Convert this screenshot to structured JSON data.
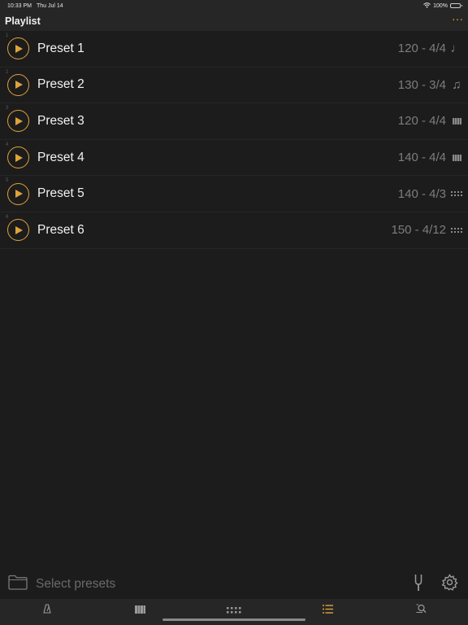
{
  "status": {
    "time": "10:33 PM",
    "date": "Thu Jul 14",
    "battery": "100%"
  },
  "header": {
    "title": "Playlist",
    "more_label": "···"
  },
  "presets": [
    {
      "index": "1",
      "name": "Preset 1",
      "meta": "120 - 4/4",
      "icon": "quarter-note-icon"
    },
    {
      "index": "2",
      "name": "Preset 2",
      "meta": "130 - 3/4",
      "icon": "eighth-notes-icon"
    },
    {
      "index": "3",
      "name": "Preset 3",
      "meta": "120 - 4/4",
      "icon": "bars-icon"
    },
    {
      "index": "4",
      "name": "Preset 4",
      "meta": "140 - 4/4",
      "icon": "bars-icon"
    },
    {
      "index": "5",
      "name": "Preset 5",
      "meta": "140 - 4/3",
      "icon": "dots-grid-icon"
    },
    {
      "index": "6",
      "name": "Preset 6",
      "meta": "150 - 4/12",
      "icon": "dots-grid-icon"
    }
  ],
  "toolbar": {
    "select_label": "Select presets"
  },
  "tabs": [
    {
      "name": "metronome",
      "active": false
    },
    {
      "name": "bars",
      "active": false
    },
    {
      "name": "dots",
      "active": false
    },
    {
      "name": "playlist",
      "active": true
    },
    {
      "name": "search",
      "active": false
    }
  ],
  "colors": {
    "accent": "#e0a23a",
    "background": "#1c1c1c",
    "bar": "#262626",
    "muted": "#7d7d7d"
  }
}
